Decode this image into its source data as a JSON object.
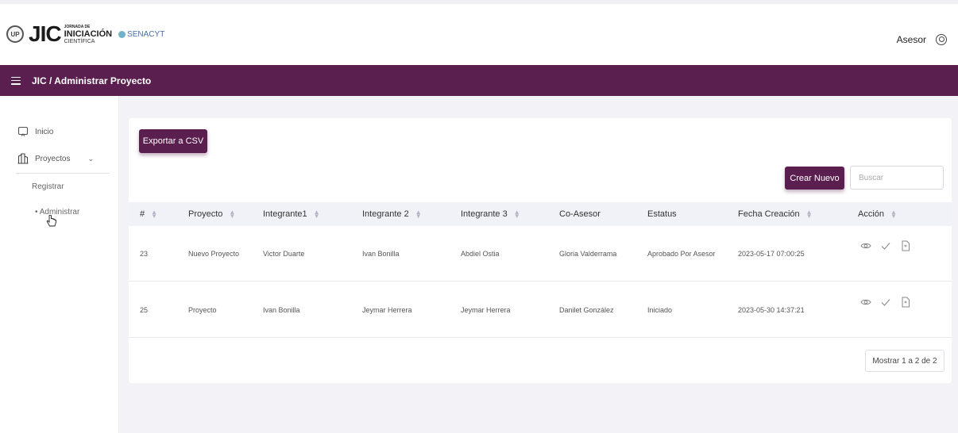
{
  "header": {
    "logo": {
      "seal_text": "UP",
      "brand": "JIC",
      "line1": "JORNADA DE",
      "line2": "INICIACIÓN",
      "line3": "CIENTÍFICA",
      "partner": "SENACYT"
    },
    "user_label": "Asesor"
  },
  "navbar": {
    "breadcrumb": "JIC / Administrar Proyecto"
  },
  "sidebar": {
    "inicio": "Inicio",
    "proyectos": "Proyectos",
    "registrar": "Registrar",
    "administrar": "• Administrar"
  },
  "toolbar": {
    "export_label": "Exportar a CSV",
    "create_label": "Crear Nuevo",
    "search_placeholder": "Buscar"
  },
  "table": {
    "headers": [
      "#",
      "Proyecto",
      "Integrante1",
      "Integrante 2",
      "Integrante 3",
      "Co-Asesor",
      "Estatus",
      "Fecha Creación",
      "Acción"
    ],
    "rows": [
      [
        "23",
        "Nuevo Proyecto",
        "Victor Duarte",
        "Ivan Bonilla",
        "Abdiel Ostia",
        "Gloria Valderrama",
        "Aprobado Por Asesor",
        "2023-05-17 07:00:25"
      ],
      [
        "25",
        "Proyecto",
        "Ivan Bonilla",
        "Jeymar Herrera",
        "Jeymar Herrera",
        "Danilet González",
        "Iniciado",
        "2023-05-30 14:37:21"
      ]
    ]
  },
  "pagination": {
    "info": "Mostrar 1 a 2 de 2"
  },
  "colors": {
    "primary": "#5a1f4e",
    "background": "#f3f2f6",
    "header_row": "#f1f2f8"
  },
  "icons": [
    "menu-icon",
    "user-circle-icon",
    "home-icon",
    "building-icon",
    "chevron-down-icon",
    "eye-icon",
    "check-icon",
    "file-icon",
    "pointer-cursor-icon"
  ]
}
